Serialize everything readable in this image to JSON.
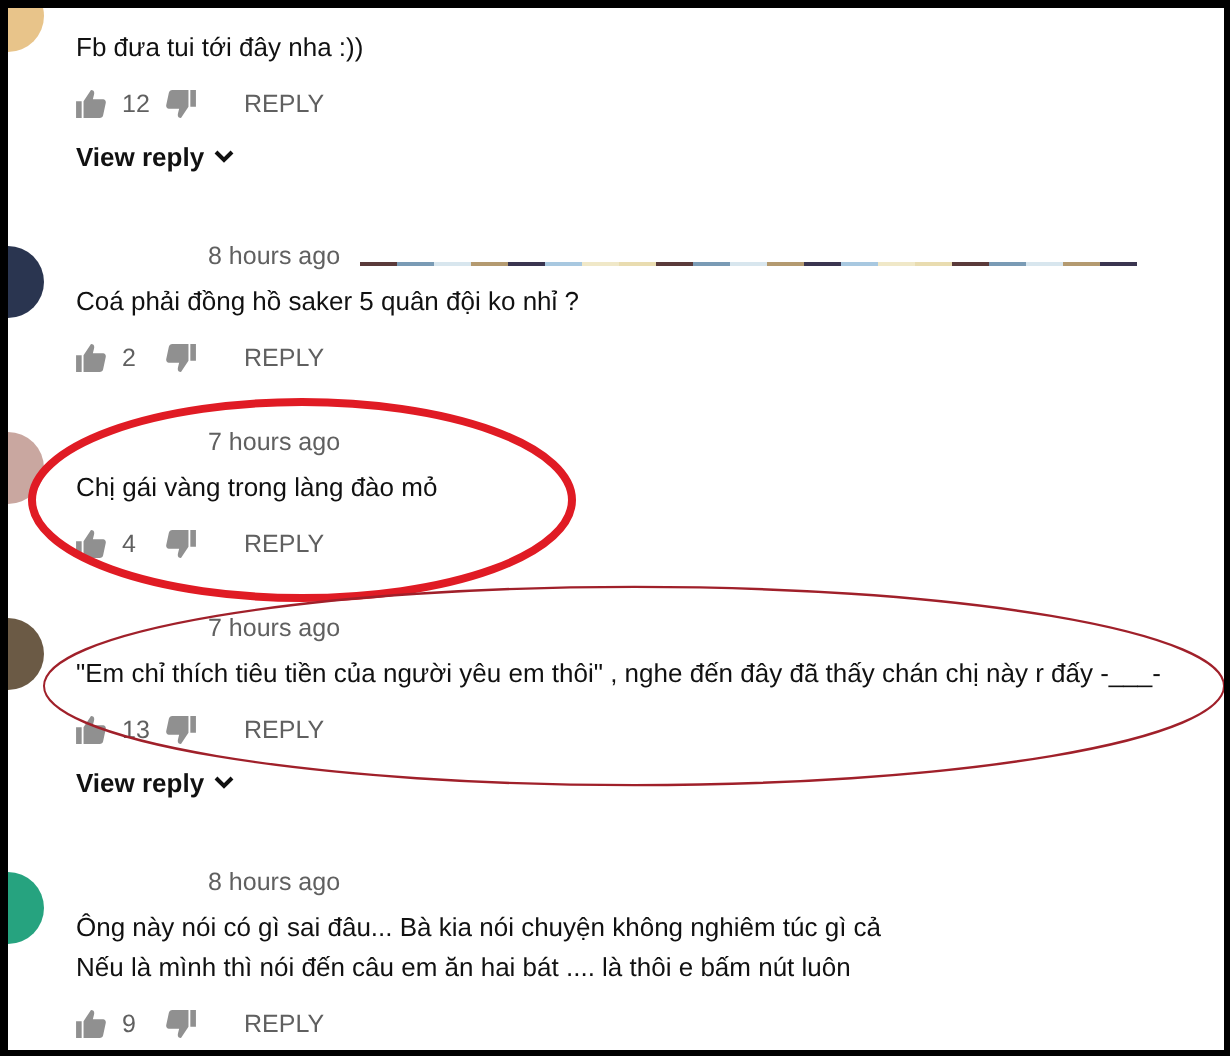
{
  "comments": [
    {
      "kind": "plain",
      "text": [
        "Fb đưa tui tới đây nha :))"
      ],
      "likes": "12",
      "reply": "REPLY",
      "view_reply": "View reply",
      "redacted": false
    },
    {
      "kind": "plain",
      "time": "8 hours ago",
      "text": [
        "Coá phải đồng hồ saker 5 quân đội ko nhỉ ?"
      ],
      "likes": "2",
      "reply": "REPLY",
      "redacted": true
    },
    {
      "kind": "circled_thick",
      "time": "7 hours ago",
      "text": [
        "Chị gái vàng trong làng đào mỏ"
      ],
      "likes": "4",
      "reply": "REPLY",
      "redacted": false
    },
    {
      "kind": "circled_thin",
      "time": "7 hours ago",
      "text": [
        "\"Em chỉ thích tiêu tiền của người yêu em thôi\" , nghe đến đây đã thấy chán chị này r đấy -___-"
      ],
      "likes": "13",
      "reply": "REPLY",
      "view_reply": "View reply",
      "redacted": false
    },
    {
      "kind": "plain",
      "time": "8 hours ago",
      "text": [
        "Ông này nói có gì sai đâu... Bà kia nói chuyện không nghiêm túc gì cả",
        "Nếu là mình thì nói đến câu em ăn hai bát .... là thôi e bấm nút luôn"
      ],
      "likes": "9",
      "reply": "REPLY",
      "redacted": false
    }
  ]
}
